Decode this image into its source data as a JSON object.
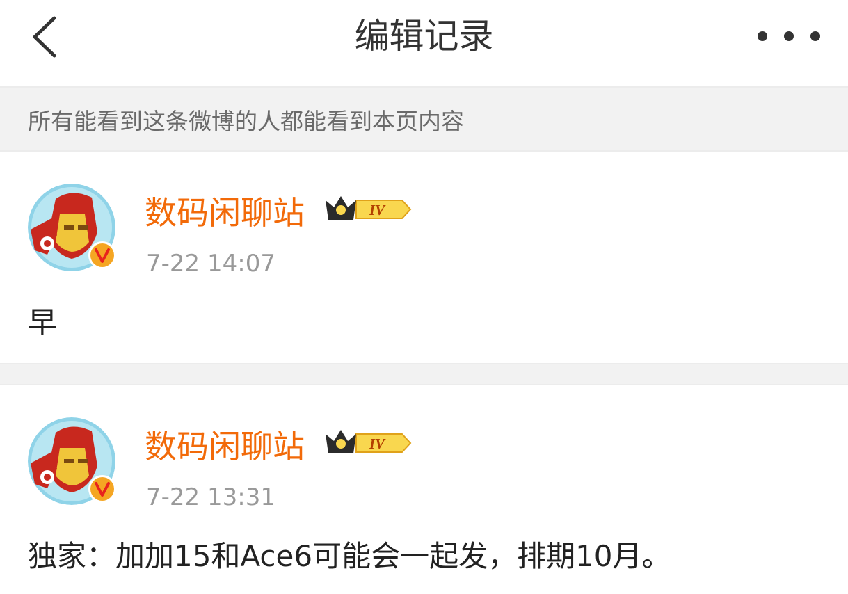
{
  "header": {
    "title": "编辑记录",
    "back_icon": "chevron-left-icon",
    "more_icon": "more-horizontal-icon"
  },
  "notice": {
    "text": "所有能看到这条微博的人都能看到本页内容"
  },
  "entries": [
    {
      "username": "数码闲聊站",
      "level": "IV",
      "timestamp": "7-22 14:07",
      "content": "早"
    },
    {
      "username": "数码闲聊站",
      "level": "IV",
      "timestamp": "7-22 13:31",
      "content": "独家：加加15和Ace6可能会一起发，排期10月。"
    }
  ],
  "colors": {
    "username": "#f26a09",
    "verified": "#f5a623",
    "text": "#222222",
    "muted": "#999999",
    "separator": "#f2f2f2"
  }
}
